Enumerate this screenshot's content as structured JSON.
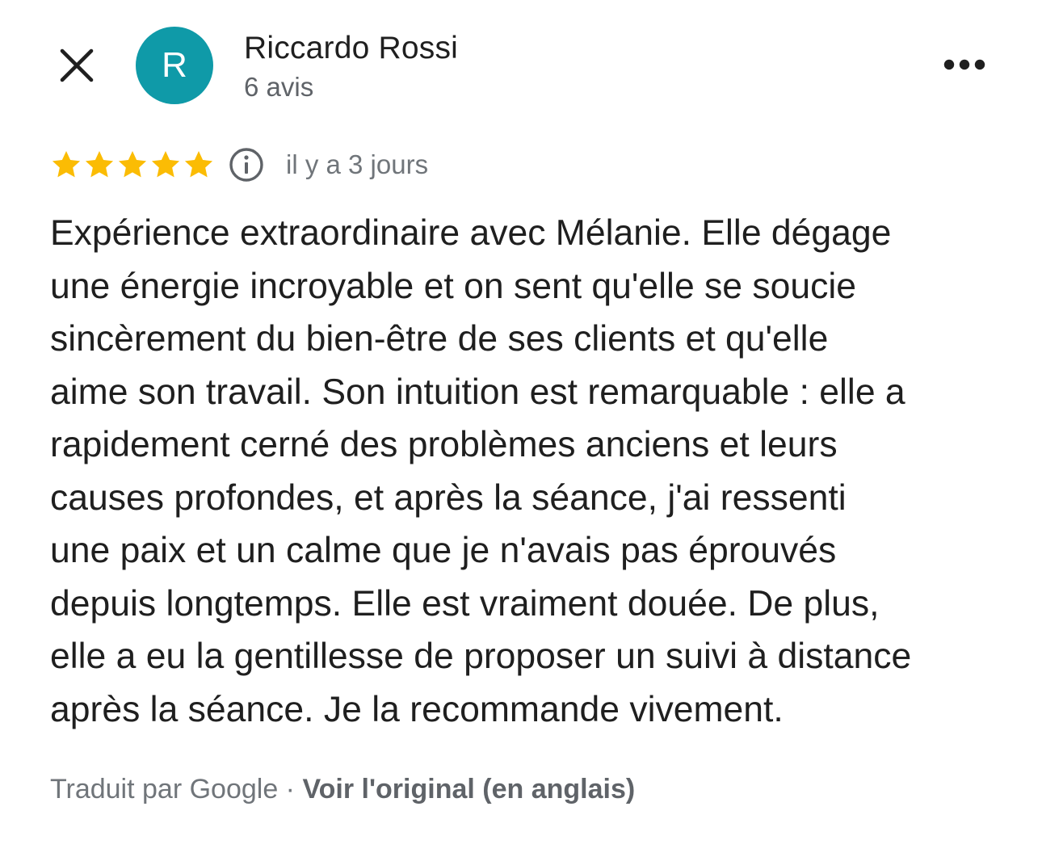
{
  "reviewer": {
    "avatar_letter": "R",
    "avatar_color": "#0f9aa8",
    "name": "Riccardo Rossi",
    "review_count": "6 avis"
  },
  "header": {
    "close_icon": "close-icon",
    "more_icon": "more-horizontal-icon"
  },
  "rating": {
    "stars": 5,
    "max_stars": 5,
    "star_color": "#fbbc04",
    "info_icon": "info-icon",
    "date": "il y a 3 jours"
  },
  "review": {
    "lines": [
      "Expérience extraordinaire avec Mélanie. Elle dégage",
      "une énergie incroyable et on sent qu'elle se soucie",
      "sincèrement du bien-être de ses clients et qu'elle",
      "aime son travail. Son intuition est remarquable : elle a",
      "rapidement cerné des problèmes anciens et leurs",
      "causes profondes, et après la séance, j'ai ressenti",
      "une paix et un calme que je n'avais pas éprouvés",
      "depuis longtemps. Elle est vraiment douée. De plus,",
      "elle a eu la gentillesse de proposer un suivi à distance",
      "après la séance. Je la recommande vivement."
    ]
  },
  "footer": {
    "translated_by": "Traduit par Google",
    "separator": " · ",
    "see_original": "Voir l'original (en anglais)"
  }
}
